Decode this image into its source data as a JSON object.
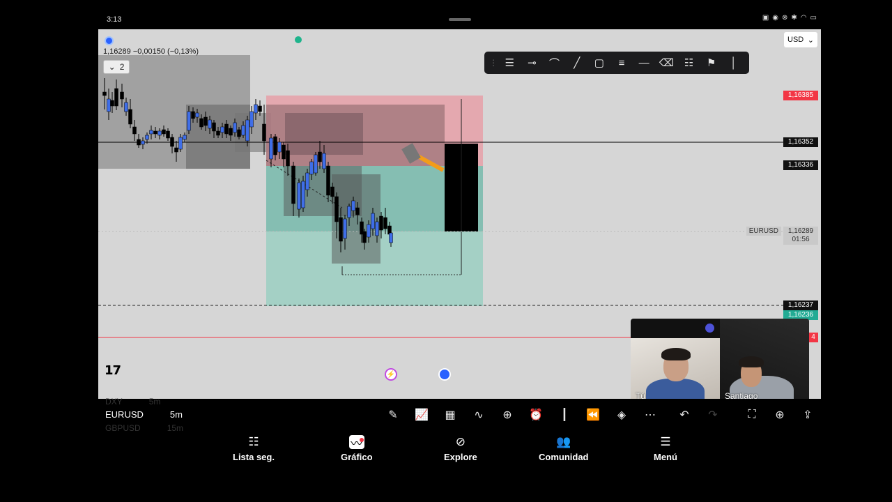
{
  "status_bar": {
    "time": "3:13",
    "icons": [
      "nfc-icon",
      "eye-icon",
      "mute-icon",
      "bluetooth-icon",
      "wifi-icon",
      "battery-icon"
    ]
  },
  "chart": {
    "ohlc_text": "1,16289 −0,00150 (−0,13%)",
    "legend_count": "2",
    "currency": "USD",
    "symbol": "EURUSD",
    "countdown": "01:56",
    "price_labels": {
      "top_red": "1,16385",
      "crosshair": "1,16352",
      "entry": "1,16336",
      "current": "1,16289",
      "dashed": "1,16237",
      "green": "1,16236",
      "red_line_suffix": "4"
    },
    "drawing_tools": [
      "grip-icon",
      "trend-lines-icon",
      "horizontal-ray-icon",
      "curve-icon",
      "line-icon",
      "rectangle-icon",
      "fib-icon",
      "horizontal-line-icon",
      "eraser-icon",
      "settings-icon",
      "flag-icon",
      "vertical-line-icon"
    ]
  },
  "video_call": {
    "you_label": "Tú",
    "other_label": "Santiago"
  },
  "bottom_toolbar": {
    "symbols": [
      {
        "symbol": "DXY",
        "interval": "5m"
      },
      {
        "symbol": "EURUSD",
        "interval": "5m"
      },
      {
        "symbol": "GBPUSD",
        "interval": "15m"
      }
    ],
    "icons": [
      "pencil-icon",
      "indicators-icon",
      "templates-icon",
      "compare-icon",
      "add-icon",
      "alert-icon",
      "candles-icon",
      "replay-icon",
      "layers-icon",
      "more-icon",
      "undo-icon",
      "redo-icon"
    ],
    "right_icons": [
      "fullscreen-icon",
      "idea-icon",
      "share-icon"
    ]
  },
  "nav": {
    "items": [
      {
        "label": "Lista seg.",
        "icon": "watchlist-icon"
      },
      {
        "label": "Gráfico",
        "icon": "chart-icon"
      },
      {
        "label": "Explore",
        "icon": "compass-icon"
      },
      {
        "label": "Comunidad",
        "icon": "community-icon"
      },
      {
        "label": "Menú",
        "icon": "menu-icon"
      }
    ]
  }
}
